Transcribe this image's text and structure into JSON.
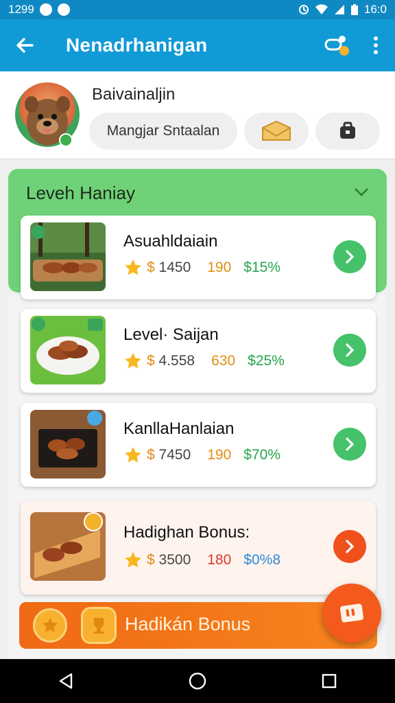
{
  "status_bar": {
    "time_left": "1299",
    "time_right": "16:0",
    "icons": [
      "notification-dot-icon",
      "notification-dot-icon",
      "alarm-icon",
      "wifi-icon",
      "signal-icon",
      "battery-icon"
    ]
  },
  "app_bar": {
    "title": "Nenadrhanigan",
    "back_icon": "arrow-left-icon",
    "share_icon": "share-icon",
    "menu_icon": "more-vertical-icon"
  },
  "profile": {
    "name": "Baivainaljin",
    "chip_text": "Mangjar Sntaalan",
    "chip_icon1": "envelope-icon",
    "chip_icon2": "bag-icon"
  },
  "level": {
    "title": "Leveh Haniay",
    "chevron_icon": "chevron-down-icon"
  },
  "items": [
    {
      "title": "Asuahldaiain",
      "currency": "$",
      "price": "1450",
      "count": "190",
      "pct": "$15%"
    },
    {
      "title": "Level· Saijan",
      "currency": "$",
      "price": "4.558",
      "count": "630",
      "pct": "$25%"
    },
    {
      "title": "KanllaHanlaian",
      "currency": "$",
      "price": "7450",
      "count": "190",
      "pct": "$70%"
    },
    {
      "title": "Hadighan Bonus:",
      "currency": "$",
      "price": "3500",
      "count": "180",
      "pct": "$0%8"
    }
  ],
  "banner": {
    "label": "Hadikán Bonus"
  },
  "colors": {
    "app_bar": "#109ad6",
    "status_bar": "#0f89c4",
    "level_green": "#6fd278",
    "go_green": "#45c26a",
    "accent_orange": "#f0501c"
  },
  "nav": {
    "back": "nav-back-icon",
    "home": "nav-home-icon",
    "recents": "nav-recents-icon"
  }
}
